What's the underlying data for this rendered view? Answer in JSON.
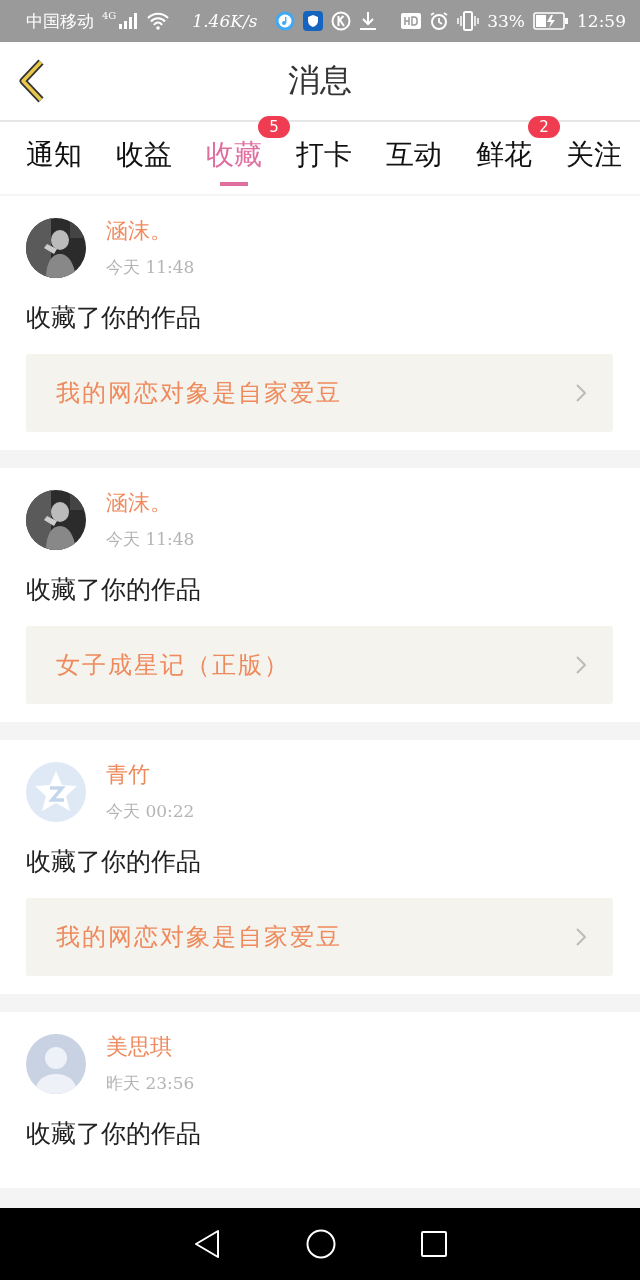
{
  "status_bar": {
    "carrier": "中国移动",
    "network": "4G",
    "speed": "1.46K/s",
    "battery": "33%",
    "time": "12:59"
  },
  "header": {
    "title": "消息"
  },
  "tabs": [
    {
      "label": "通知",
      "selected": false
    },
    {
      "label": "收益",
      "selected": false
    },
    {
      "label": "收藏",
      "selected": true,
      "badge": "5"
    },
    {
      "label": "打卡",
      "selected": false
    },
    {
      "label": "互动",
      "selected": false
    },
    {
      "label": "鲜花",
      "selected": false,
      "badge": "2"
    },
    {
      "label": "关注",
      "selected": false
    }
  ],
  "messages": [
    {
      "name": "涵沫。",
      "time": "今天 11:48",
      "action": "收藏了你的作品",
      "work": "我的网恋对象是自家爱豆"
    },
    {
      "name": "涵沫。",
      "time": "今天 11:48",
      "action": "收藏了你的作品",
      "work": "女子成星记（正版）"
    },
    {
      "kind": "star",
      "name": "青竹",
      "time": "今天 00:22",
      "action": "收藏了你的作品",
      "work": "我的网恋对象是自家爱豆"
    },
    {
      "kind": "silhouette",
      "name": "美思琪",
      "time": "昨天 23:56",
      "action": "收藏了你的作品"
    }
  ]
}
